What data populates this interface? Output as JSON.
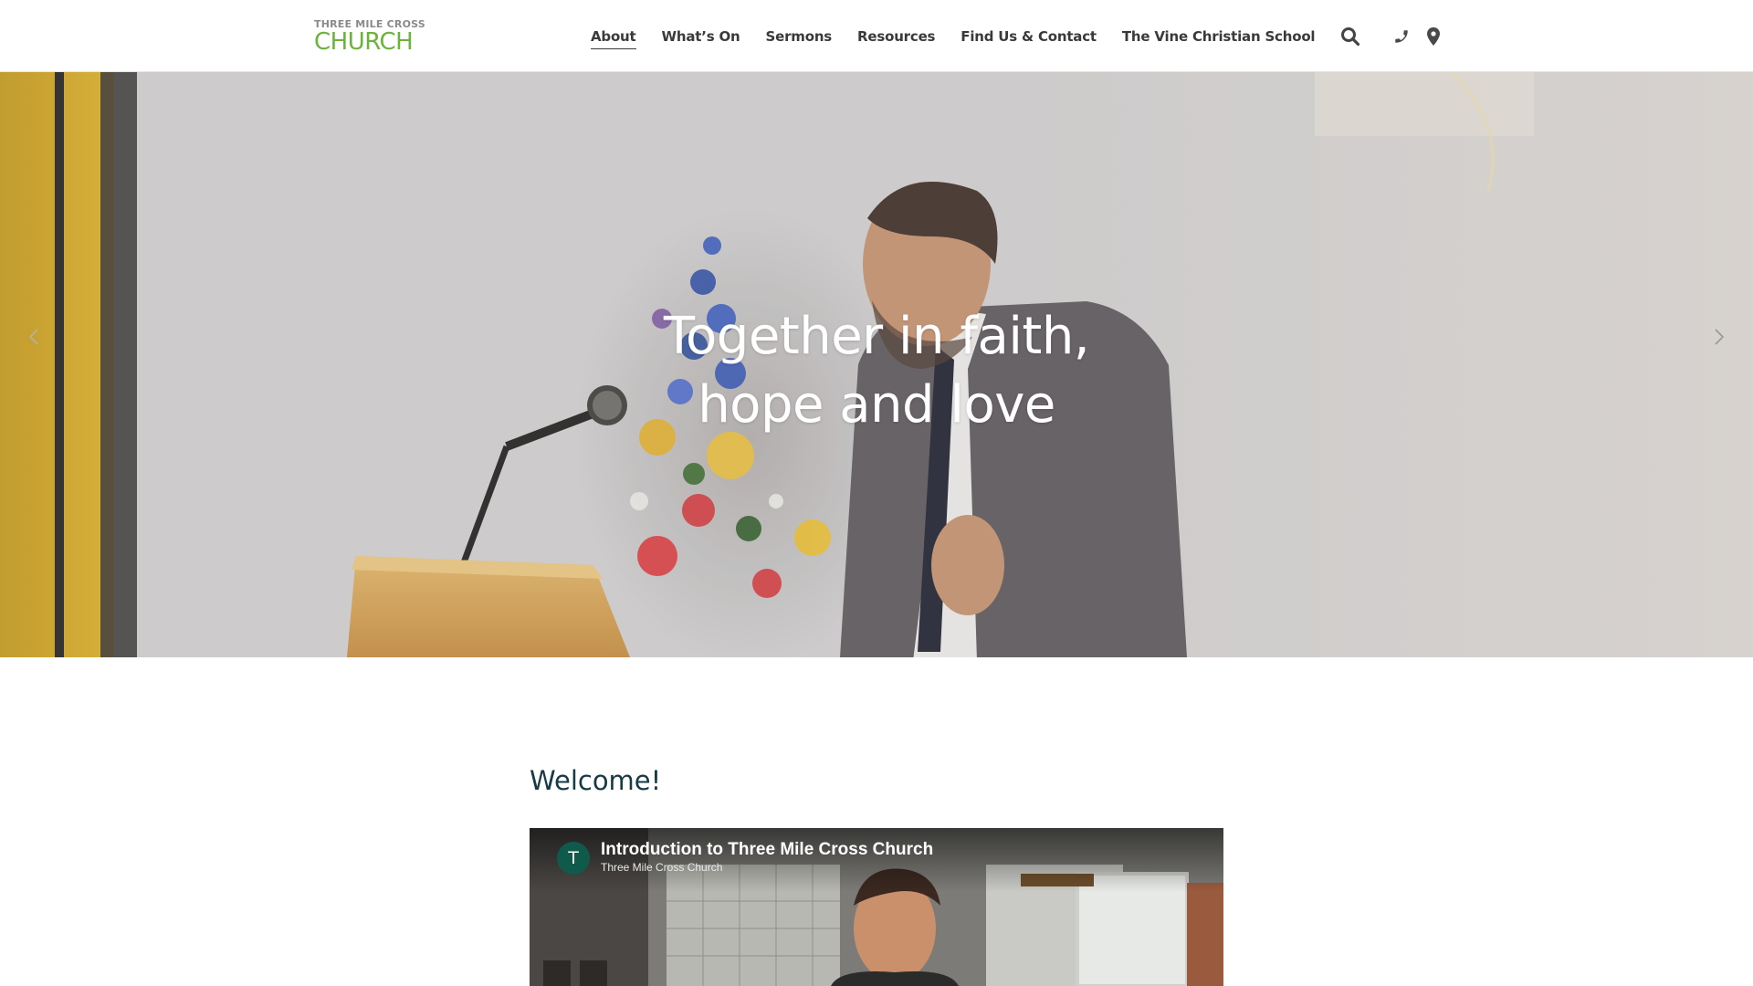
{
  "header": {
    "logo_small": "THREE MILE CROSS",
    "logo_big": "CHURCH",
    "nav": [
      {
        "label": "About",
        "active": true
      },
      {
        "label": "What’s On",
        "active": false
      },
      {
        "label": "Sermons",
        "active": false
      },
      {
        "label": "Resources",
        "active": false
      },
      {
        "label": "Find Us & Contact",
        "active": false
      },
      {
        "label": "The Vine Christian School",
        "active": false
      }
    ],
    "icons": [
      "search-icon",
      "phone-icon",
      "location-pin-icon"
    ]
  },
  "hero": {
    "title_line1": "Together in faith,",
    "title_line2": "hope and love",
    "prev_icon": "chevron-left-icon",
    "next_icon": "chevron-right-icon"
  },
  "main": {
    "heading": "Welcome!",
    "video": {
      "title": "Introduction to Three Mile Cross Church",
      "channel": "Three Mile Cross Church",
      "channel_initial": "T"
    }
  },
  "colors": {
    "brand_green": "#6cb33e",
    "heading_teal": "#173a44",
    "nav_text": "#3a3a3a"
  }
}
